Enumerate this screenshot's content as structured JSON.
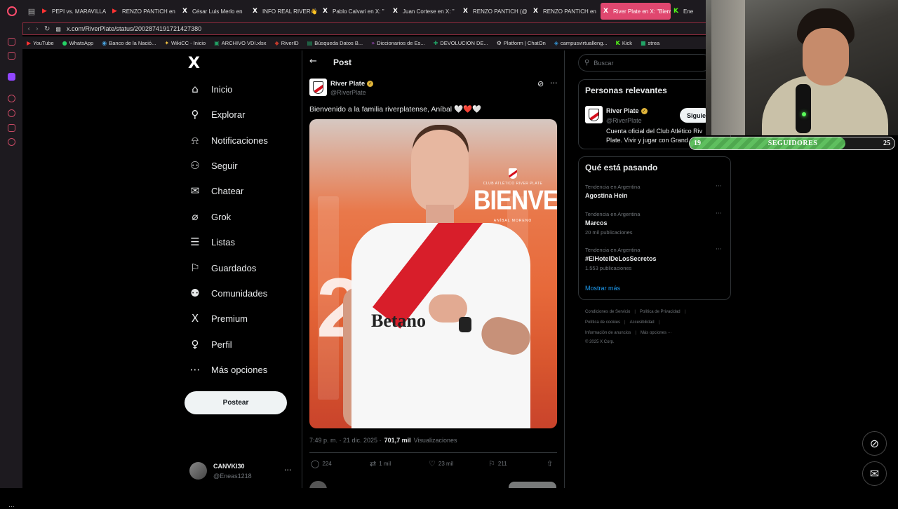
{
  "browser": {
    "tabs": [
      {
        "icon": "youtube-icon",
        "title": "PEPI vs. MARAVILLA"
      },
      {
        "icon": "youtube-icon",
        "title": "RENZO PANTICH en"
      },
      {
        "icon": "x-icon",
        "title": "César Luis Merlo en"
      },
      {
        "icon": "x-icon",
        "title": "INFO REAL RIVER👋"
      },
      {
        "icon": "x-icon",
        "title": "Pablo Calvari en X: \""
      },
      {
        "icon": "x-icon",
        "title": "Juan Cortese en X: \""
      },
      {
        "icon": "x-icon",
        "title": "RENZO PANTICH (@"
      },
      {
        "icon": "x-icon",
        "title": "RENZO PANTICH en"
      },
      {
        "icon": "x-icon",
        "title": "River Plate en X: \"Bienve",
        "active": true
      },
      {
        "icon": "kick-icon",
        "title": "Ene"
      }
    ],
    "url": "x.com/RiverPlate/status/2002874191721427380",
    "bookmarks": [
      "YouTube",
      "WhatsApp",
      "Banco de la Nació...",
      "WikiCC - Inicio",
      "ARCHIVO VDI.xlsx",
      "RiverID",
      "Búsqueda Datos B...",
      "Diccionarios de Es...",
      "DEVOLUCION DE...",
      "Platform | ChatOn",
      "campusvirtualleng...",
      "Kick",
      "strea"
    ],
    "strip_label": "OX",
    "strip_more": "..."
  },
  "nav": {
    "logo": "X",
    "items": [
      {
        "icon": "home-icon",
        "glyph": "⌂",
        "label": "Inicio"
      },
      {
        "icon": "search-icon",
        "glyph": "⚲",
        "label": "Explorar"
      },
      {
        "icon": "bell-icon",
        "glyph": "⍾",
        "label": "Notificaciones"
      },
      {
        "icon": "person-add-icon",
        "glyph": "⚇",
        "label": "Seguir"
      },
      {
        "icon": "mail-icon",
        "glyph": "✉",
        "label": "Chatear"
      },
      {
        "icon": "grok-icon",
        "glyph": "⌀",
        "label": "Grok"
      },
      {
        "icon": "list-icon",
        "glyph": "☰",
        "label": "Listas"
      },
      {
        "icon": "bookmark-icon",
        "glyph": "⚐",
        "label": "Guardados"
      },
      {
        "icon": "communities-icon",
        "glyph": "⚉",
        "label": "Comunidades"
      },
      {
        "icon": "x-premium-icon",
        "glyph": "X",
        "label": "Premium"
      },
      {
        "icon": "profile-icon",
        "glyph": "♀",
        "label": "Perfil"
      },
      {
        "icon": "more-options-icon",
        "glyph": "⋯",
        "label": "Más opciones"
      }
    ],
    "post_button": "Postear",
    "account": {
      "name": "CANVKI30",
      "handle": "@Eneas1218",
      "more": "···"
    }
  },
  "post": {
    "header": "Post",
    "author": {
      "name": "River Plate",
      "handle": "@RiverPlate"
    },
    "text": "Bienvenido a la familia riverplatense, Aníbal 🤍❤️🤍",
    "image": {
      "club": "CLUB ATLÉTICO RIVER PLATE",
      "headline": "BIENVENIDO",
      "player": "ANÍBAL MORENO",
      "sponsor": "Betano"
    },
    "meta": {
      "time": "7:49 p. m. · 21 dic. 2025 ·",
      "views": "701,7 mil",
      "views_label": "Visualizaciones"
    },
    "actions": {
      "replies": "224",
      "reposts": "1 mil",
      "likes": "23 mil",
      "bookmarks": "211"
    }
  },
  "right": {
    "search_placeholder": "Buscar",
    "relevant": {
      "title": "Personas relevantes",
      "name": "River Plate",
      "handle": "@RiverPlate",
      "bio_line1": "Cuenta oficial del Club Atlético Riv",
      "bio_line2": "Plate. Vivir y jugar con Grand",
      "follow": "Siguie"
    },
    "trends": {
      "title": "Qué está pasando",
      "items": [
        {
          "context": "Tendencia en Argentina",
          "name": "Agostina Hein",
          "count": ""
        },
        {
          "context": "Tendencia en Argentina",
          "name": "Marcos",
          "count": "20 mil publicaciones"
        },
        {
          "context": "Tendencia en Argentina",
          "name": "#ElHotelDeLosSecretos",
          "count": "1.553 publicaciones"
        }
      ],
      "show_more": "Mostrar más"
    },
    "footer": {
      "row1": [
        "Condiciones de Servicio",
        "Política de Privacidad"
      ],
      "row2": [
        "Política de cookies",
        "Accesibilidad"
      ],
      "row3": [
        "Información de anuncios",
        "Más opciones ···"
      ],
      "copyright": "© 2025 X Corp."
    }
  },
  "overlay": {
    "followers_label": "SEGUIDORES",
    "followers_current": "19",
    "followers_goal": "25",
    "followers_progress": 0.76
  }
}
